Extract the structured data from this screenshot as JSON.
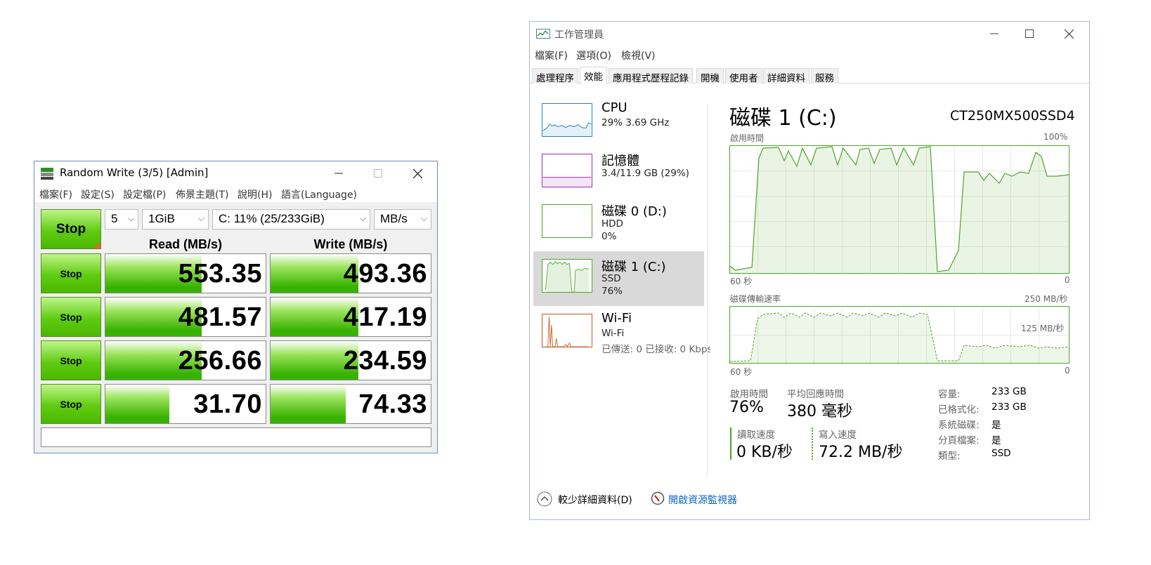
{
  "cdm": {
    "title": "Random Write (3/5) [Admin]",
    "menu": [
      "檔案(F)",
      "設定(S)",
      "設定檔(P)",
      "佈景主題(T)",
      "說明(H)",
      "語言(Language)"
    ],
    "main_button": "Stop",
    "count": "5",
    "size": "1GiB",
    "drive": "C: 11% (25/233GiB)",
    "unit": "MB/s",
    "read_header": "Read (MB/s)",
    "write_header": "Write (MB/s)",
    "rows": [
      {
        "button": "Stop",
        "read": "553.35",
        "write": "493.36",
        "read_fill": 0.6,
        "write_fill": 0.55
      },
      {
        "button": "Stop",
        "read": "481.57",
        "write": "417.19",
        "read_fill": 0.6,
        "write_fill": 0.55
      },
      {
        "button": "Stop",
        "read": "256.66",
        "write": "234.59",
        "read_fill": 0.6,
        "write_fill": 0.55
      },
      {
        "button": "Stop",
        "read": "31.70",
        "write": "74.33",
        "read_fill": 0.4,
        "write_fill": 0.47
      }
    ],
    "accent": "#4bb800"
  },
  "tm": {
    "title": "工作管理員",
    "menu": [
      "檔案(F)",
      "選項(O)",
      "檢視(V)"
    ],
    "tabs": [
      "處理程序",
      "效能",
      "應用程式歷程記錄",
      "開機",
      "使用者",
      "詳細資料",
      "服務"
    ],
    "sidebar": [
      {
        "name": "CPU",
        "line1": "29% 3.69 GHz",
        "line2": "",
        "color": "#1f83c6"
      },
      {
        "name": "記憶體",
        "line1": "3.4/11.9 GB (29%)",
        "line2": "",
        "color": "#9b2db5"
      },
      {
        "name": "磁碟 0 (D:)",
        "line1": "HDD",
        "line2": "0%",
        "color": "#4fa42a"
      },
      {
        "name": "磁碟 1 (C:)",
        "line1": "SSD",
        "line2": "76%",
        "color": "#4fa42a"
      },
      {
        "name": "Wi-Fi",
        "line1": "Wi-Fi",
        "line2": "已傳送: 0 已接收: 0 Kbps",
        "color": "#c4561c"
      }
    ],
    "heading": "磁碟 1 (C:)",
    "model": "CT250MX500SSD4",
    "graph1": {
      "label": "啟用時間",
      "max": "100%",
      "left": "60 秒",
      "right": "0"
    },
    "graph2": {
      "label": "磁碟傳輸速率",
      "max": "250 MB/秒",
      "mid": "125 MB/秒",
      "left": "60 秒",
      "right": "0"
    },
    "stats": {
      "active_label": "啟用時間",
      "active_value": "76%",
      "resp_label": "平均回應時間",
      "resp_value": "380 毫秒",
      "read_label": "讀取速度",
      "read_value": "0 KB/秒",
      "write_label": "寫入速度",
      "write_value": "72.2 MB/秒"
    },
    "props": [
      {
        "k": "容量:",
        "v": "233 GB"
      },
      {
        "k": "已格式化:",
        "v": "233 GB"
      },
      {
        "k": "系統磁碟:",
        "v": "是"
      },
      {
        "k": "分頁檔案:",
        "v": "是"
      },
      {
        "k": "類型:",
        "v": "SSD"
      }
    ],
    "fewer_details": "較少詳細資料(D)",
    "open_monitor": "開啟資源監視器",
    "accent": "#4fa42a"
  }
}
